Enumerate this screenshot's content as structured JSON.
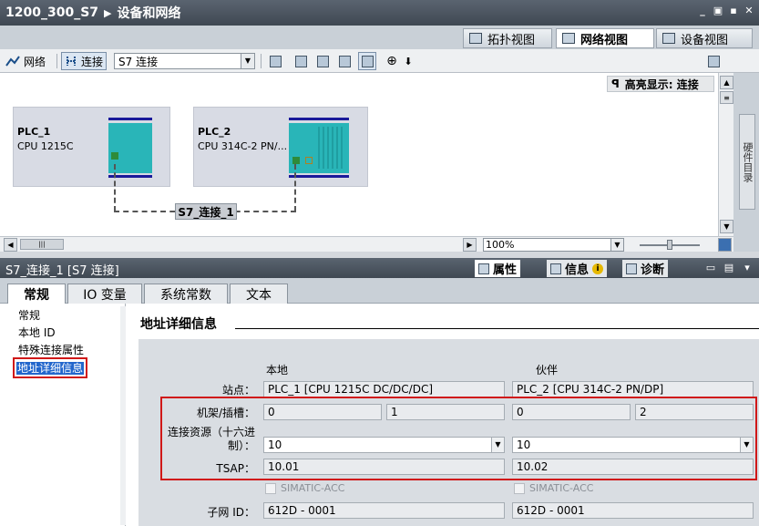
{
  "title": {
    "project": "1200_300_S7",
    "page": "设备和网络"
  },
  "view_tabs": [
    "拓扑视图",
    "网络视图",
    "设备视图"
  ],
  "toolbar": {
    "network_label": "网络",
    "connect_label": "连接",
    "connection_type": "S7 连接"
  },
  "highlight": "高亮显示: 连接",
  "devices": [
    {
      "name": "PLC_1",
      "cpu": "CPU 1215C"
    },
    {
      "name": "PLC_2",
      "cpu": "CPU 314C-2 PN/..."
    }
  ],
  "connection_label": "S7_连接_1",
  "zoom": "100%",
  "side_panel": "硬件目录",
  "inspector": {
    "title": "S7_连接_1 [S7 连接]",
    "tabs": [
      "属性",
      "信息",
      "诊断"
    ],
    "subtabs": [
      "常规",
      "IO 变量",
      "系统常数",
      "文本"
    ],
    "nav": [
      "常规",
      "本地 ID",
      "特殊连接属性",
      "地址详细信息"
    ],
    "section_title": "地址详细信息",
    "columns": {
      "local": "本地",
      "partner": "伙伴"
    },
    "labels": {
      "station": "站点：",
      "rack_slot": "机架/插槽：",
      "conn_resource": "连接资源（十六进制）：",
      "tsap": "TSAP：",
      "subnet_id": "子网 ID："
    },
    "local": {
      "station": "PLC_1 [CPU 1215C DC/DC/DC]",
      "rack": "0",
      "slot": "1",
      "resource": "10",
      "tsap": "10.01",
      "simatic": "SIMATIC-ACC",
      "subnet": "612D - 0001"
    },
    "partner": {
      "station": "PLC_2 [CPU 314C-2 PN/DP]",
      "rack": "0",
      "slot": "2",
      "resource": "10",
      "tsap": "10.02",
      "simatic": "SIMATIC-ACC",
      "subnet": "612D - 0001"
    }
  }
}
